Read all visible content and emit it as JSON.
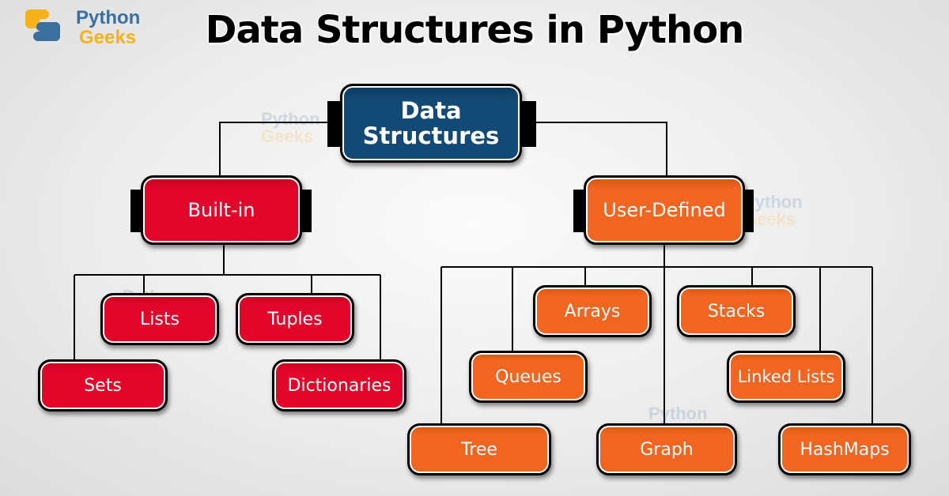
{
  "brand": {
    "logo_line1": "Python",
    "logo_line2": "Geeks",
    "colors": {
      "blue": "#3a6f9e",
      "yellow": "#f6b21c"
    }
  },
  "title": "Data Structures in Python",
  "diagram": {
    "root": {
      "label": "Data Structures",
      "label_line1": "Data",
      "label_line2": "Structures",
      "color": "#124a75"
    },
    "branches": [
      {
        "label": "Built-in",
        "color": "#e2062b",
        "children": [
          "Lists",
          "Tuples",
          "Sets",
          "Dictionaries"
        ]
      },
      {
        "label": "User-Defined",
        "color": "#f16521",
        "children": [
          "Arrays",
          "Stacks",
          "Queues",
          "Linked Lists",
          "Tree",
          "Graph",
          "HashMaps"
        ]
      }
    ]
  },
  "watermark": {
    "line1": "Python",
    "line2": "Geeks"
  }
}
